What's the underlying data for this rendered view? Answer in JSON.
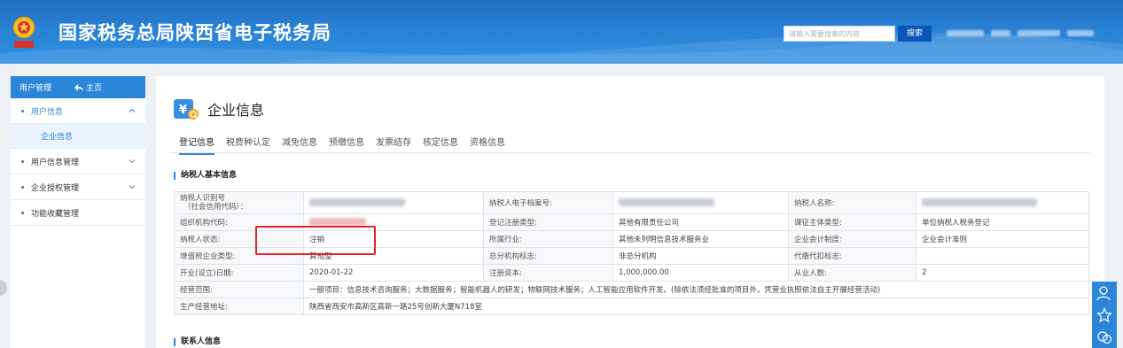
{
  "header": {
    "title": "国家税务总局陕西省电子税务局",
    "search_placeholder": "请输入需要搜索的内容",
    "search_label": "搜索"
  },
  "sidebar": {
    "top_label": "用户管理",
    "home_label": "主页",
    "items": [
      {
        "label": "用户信息"
      },
      {
        "label": "企业信息"
      },
      {
        "label": "用户信息管理"
      },
      {
        "label": "企业授权管理"
      },
      {
        "label": "功能收藏管理"
      }
    ]
  },
  "page": {
    "title": "企业信息",
    "tabs": [
      "登记信息",
      "税费种认定",
      "减免信息",
      "预缴信息",
      "发票结存",
      "核定信息",
      "资格信息"
    ],
    "section1": "纳税人基本信息",
    "section2": "联系人信息"
  },
  "table": {
    "r1": {
      "l1": "纳税人识别号",
      "l1b": "（社会信用代码）：",
      "l2": "纳税人电子档案号:",
      "l3": "纳税人名称:"
    },
    "r2": {
      "l1": "组织机构代码:",
      "l2": "登记注册类型:",
      "v2": "其他有限责任公司",
      "l3": "课征主体类型:",
      "v3": "单位纳税人税务登记"
    },
    "r3": {
      "l1": "纳税人状态:",
      "v1": "注销",
      "l2": "所属行业:",
      "v2": "其他未列明信息技术服务业",
      "l3": "企业会计制度:",
      "v3": "企业会计准则"
    },
    "r4": {
      "l1": "增值税企业类型:",
      "v1": "其他型",
      "l2": "总分机构标志:",
      "v2": "非总分机构",
      "l3": "代缴代扣标志:",
      "v3": ""
    },
    "r5": {
      "l1": "开业(设立)日期:",
      "v1": "2020-01-22",
      "l2": "注册资本:",
      "v2": "1,000,000.00",
      "l3": "从业人数:",
      "v3": "2"
    },
    "r6": {
      "l1": "经营范围:",
      "v1": "一般项目：信息技术咨询服务；大数据服务；智能机器人的研发；物联网技术服务；人工智能应用软件开发。(除依法须经批准的项目外，凭营业执照依法自主开展经营活动)"
    },
    "r7": {
      "l1": "生产经营地址:",
      "v1": "陕西省西安市高新区高新一路25号创新大厦N718室"
    }
  },
  "colors": {
    "brand": "#2b86d9",
    "highlight": "#e0262b"
  }
}
